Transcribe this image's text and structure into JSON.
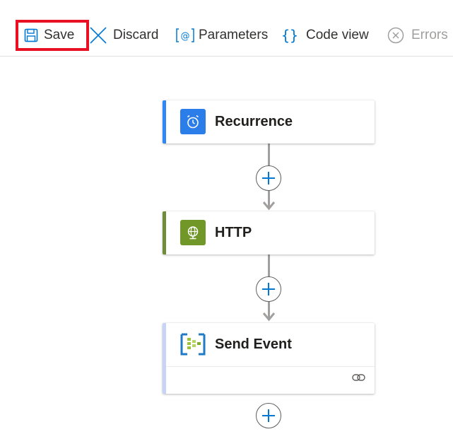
{
  "toolbar": {
    "save_label": "Save",
    "discard_label": "Discard",
    "parameters_label": "Parameters",
    "code_view_label": "Code view",
    "errors_label": "Errors"
  },
  "flow": {
    "steps": [
      {
        "title": "Recurrence",
        "icon": "clock-icon",
        "accent": "#2b7de9"
      },
      {
        "title": "HTTP",
        "icon": "globe-icon",
        "accent": "#709727"
      },
      {
        "title": "Send Event",
        "icon": "event-grid-icon",
        "accent": "#c7d4f8"
      }
    ]
  },
  "colors": {
    "highlight": "#e81123",
    "link_blue": "#0078d4",
    "disabled": "#a19f9d"
  }
}
